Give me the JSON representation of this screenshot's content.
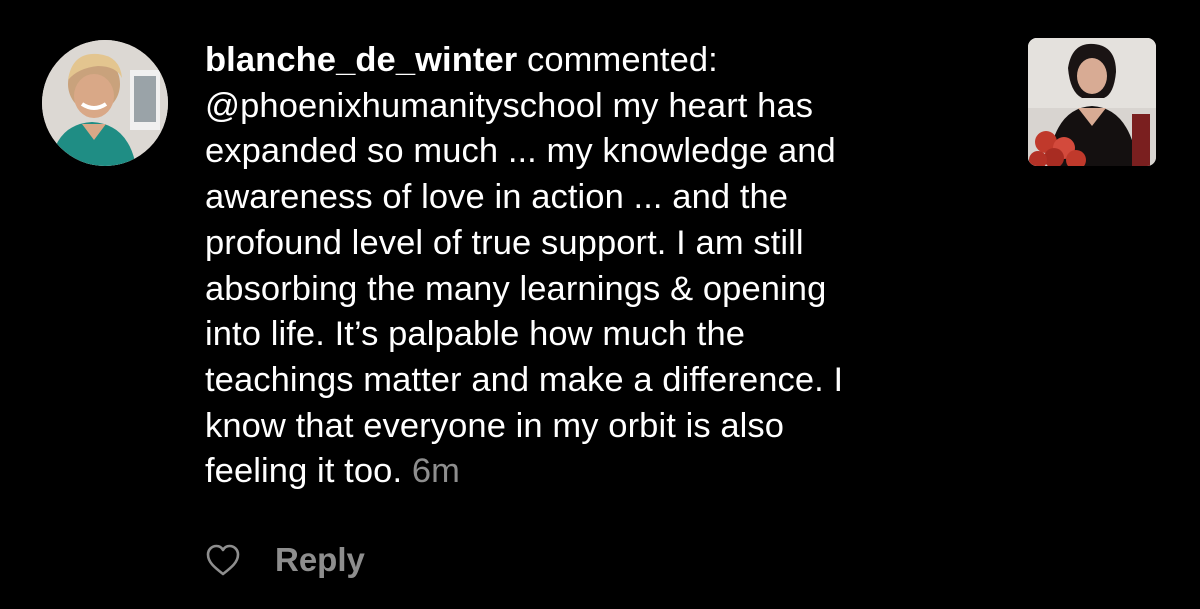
{
  "comment": {
    "username": "blanche_de_winter",
    "action": "commented:",
    "lines": [
      "@phoenixhumanityschool my heart has",
      "expanded so much ... my knowledge and",
      "awareness of love in action ... and the",
      "profound level of true support. I am still",
      "absorbing the many learnings & opening",
      "into life. It’s palpable how much the",
      "teachings matter and make a difference. I",
      "know that everyone in my orbit is also",
      "feeling it too."
    ],
    "time": "6m"
  },
  "actions": {
    "like_icon": "heart-outline-icon",
    "reply_label": "Reply"
  },
  "colors": {
    "background": "#000000",
    "text": "#ffffff",
    "muted": "#8e8e8e"
  }
}
